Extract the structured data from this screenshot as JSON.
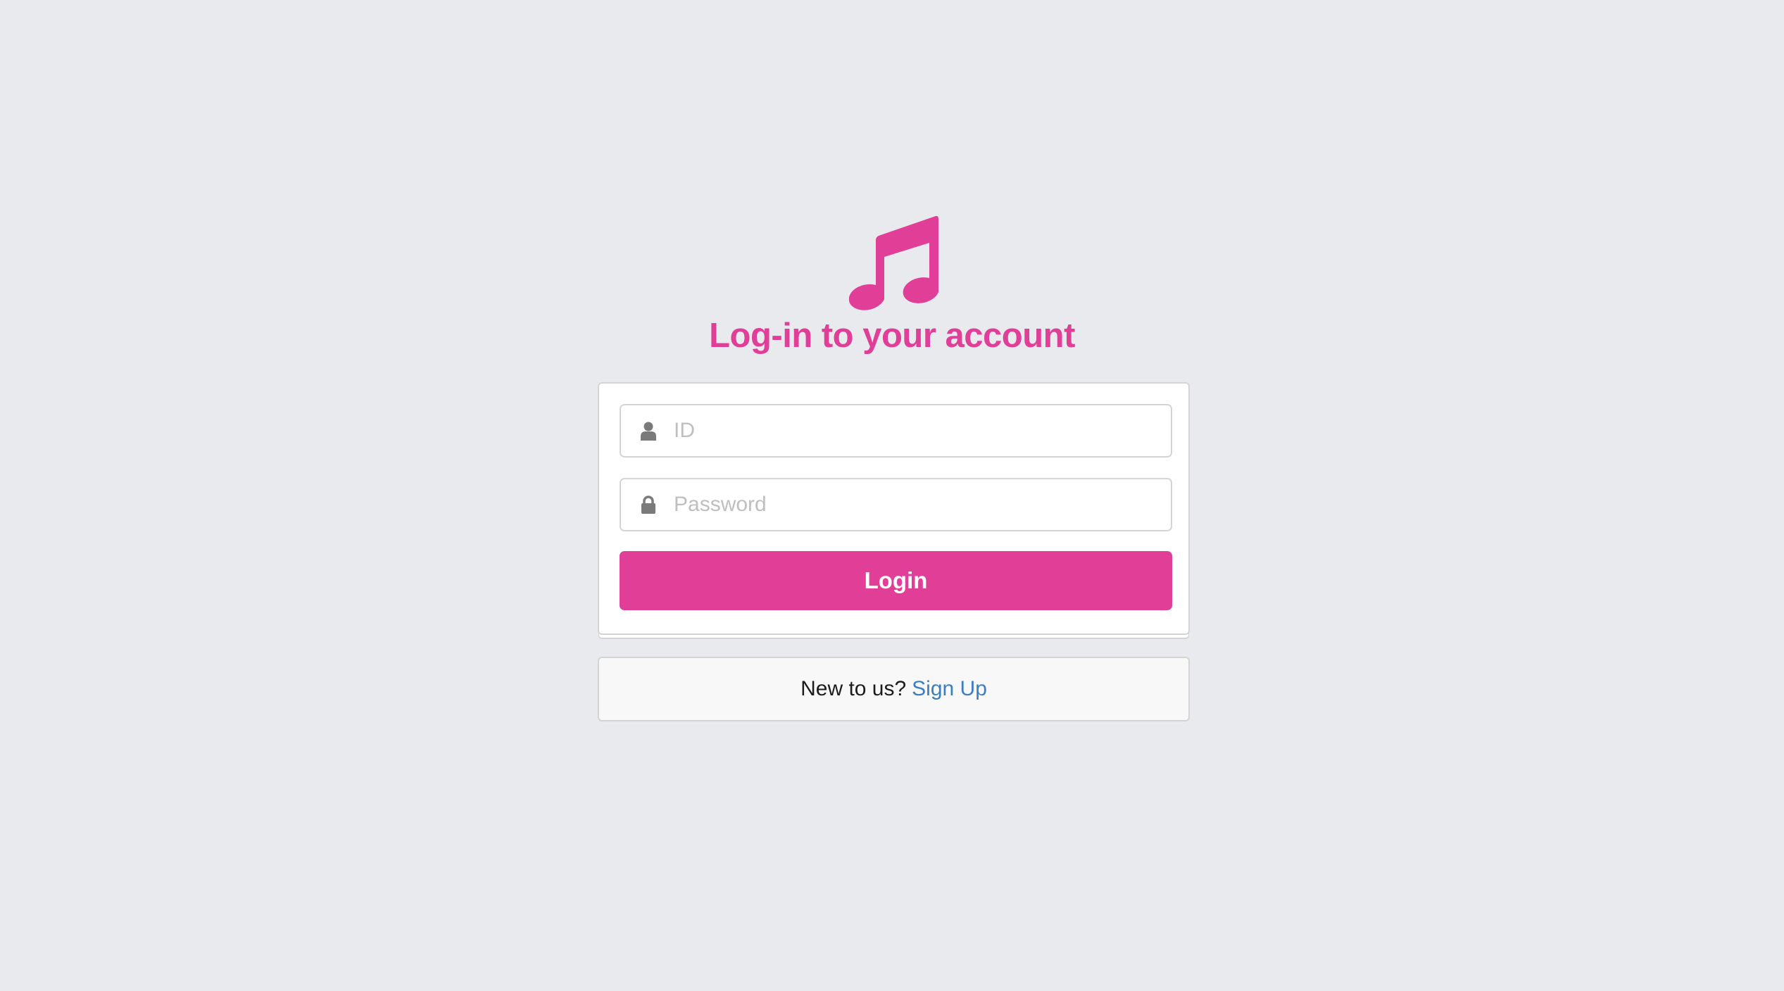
{
  "colors": {
    "brand": "#E03E97",
    "link": "#3B7EC2",
    "background": "#E9EAEE"
  },
  "header": {
    "icon": "music-note-icon",
    "title": "Log-in to your account"
  },
  "form": {
    "id_field": {
      "icon": "user-icon",
      "placeholder": "ID",
      "value": ""
    },
    "password_field": {
      "icon": "lock-icon",
      "placeholder": "Password",
      "value": ""
    },
    "submit_label": "Login"
  },
  "signup": {
    "prompt": "New to us?",
    "link_label": "Sign Up"
  }
}
